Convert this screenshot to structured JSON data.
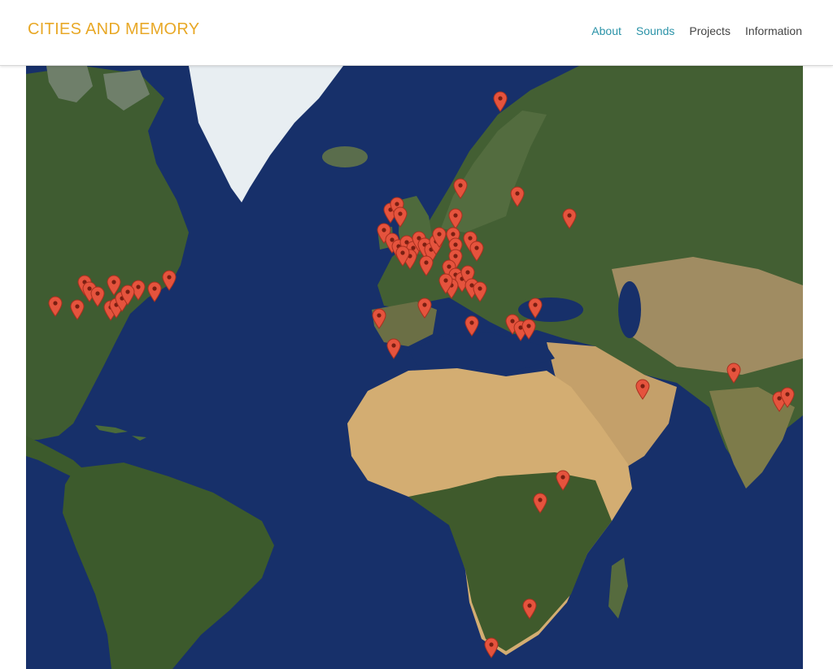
{
  "header": {
    "logo": "CITIES AND MEMORY",
    "nav": [
      {
        "label": "About",
        "active": true
      },
      {
        "label": "Sounds",
        "active": true
      },
      {
        "label": "Projects",
        "active": false
      },
      {
        "label": "Information",
        "active": false
      }
    ]
  },
  "colors": {
    "logo": "#e8a826",
    "nav_active": "#2b93a8",
    "nav_inactive": "#444444",
    "ocean": "#17306a",
    "land_forest": "#3c5a2c",
    "land_desert": "#c9a56a",
    "ice": "#e8eef2",
    "pin": "#e5533d"
  },
  "map": {
    "type": "satellite world map",
    "marker_icon": "map-marker-icon",
    "marker_count": 72
  }
}
